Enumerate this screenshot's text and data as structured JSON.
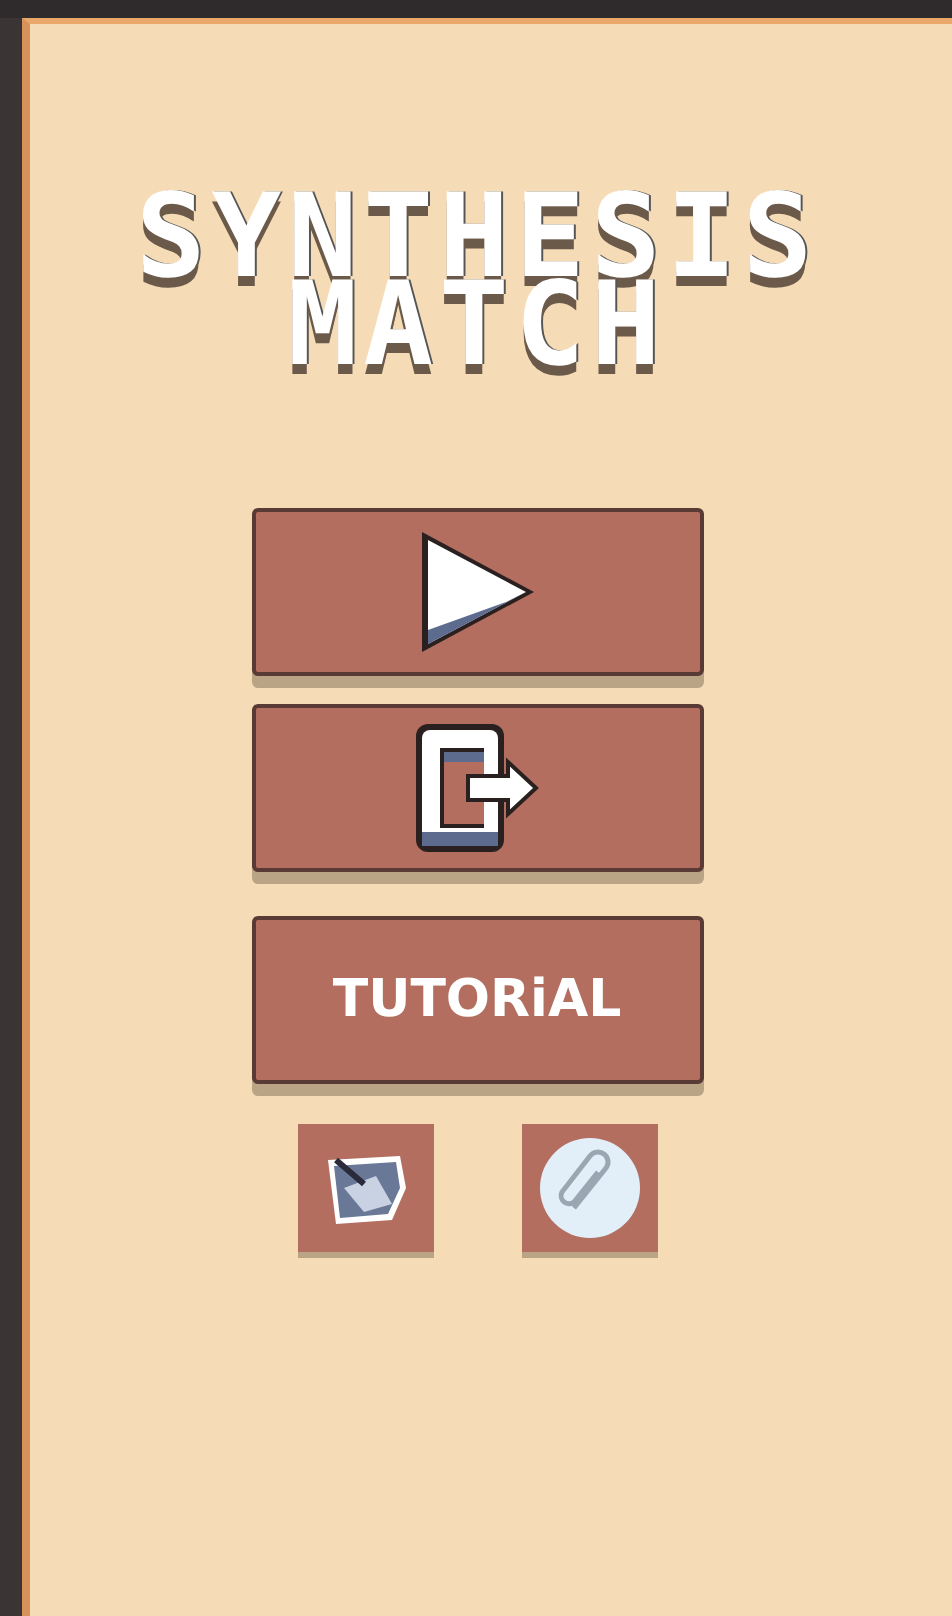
{
  "title": {
    "lines": [
      "SYNTHESIS",
      "MATCH"
    ]
  },
  "menu_buttons": [
    {
      "kind": "play"
    },
    {
      "kind": "exit"
    },
    {
      "kind": "text",
      "label": "TUTORiAL"
    }
  ],
  "icon_buttons": [
    {
      "kind": "document"
    },
    {
      "kind": "paperclip"
    }
  ]
}
